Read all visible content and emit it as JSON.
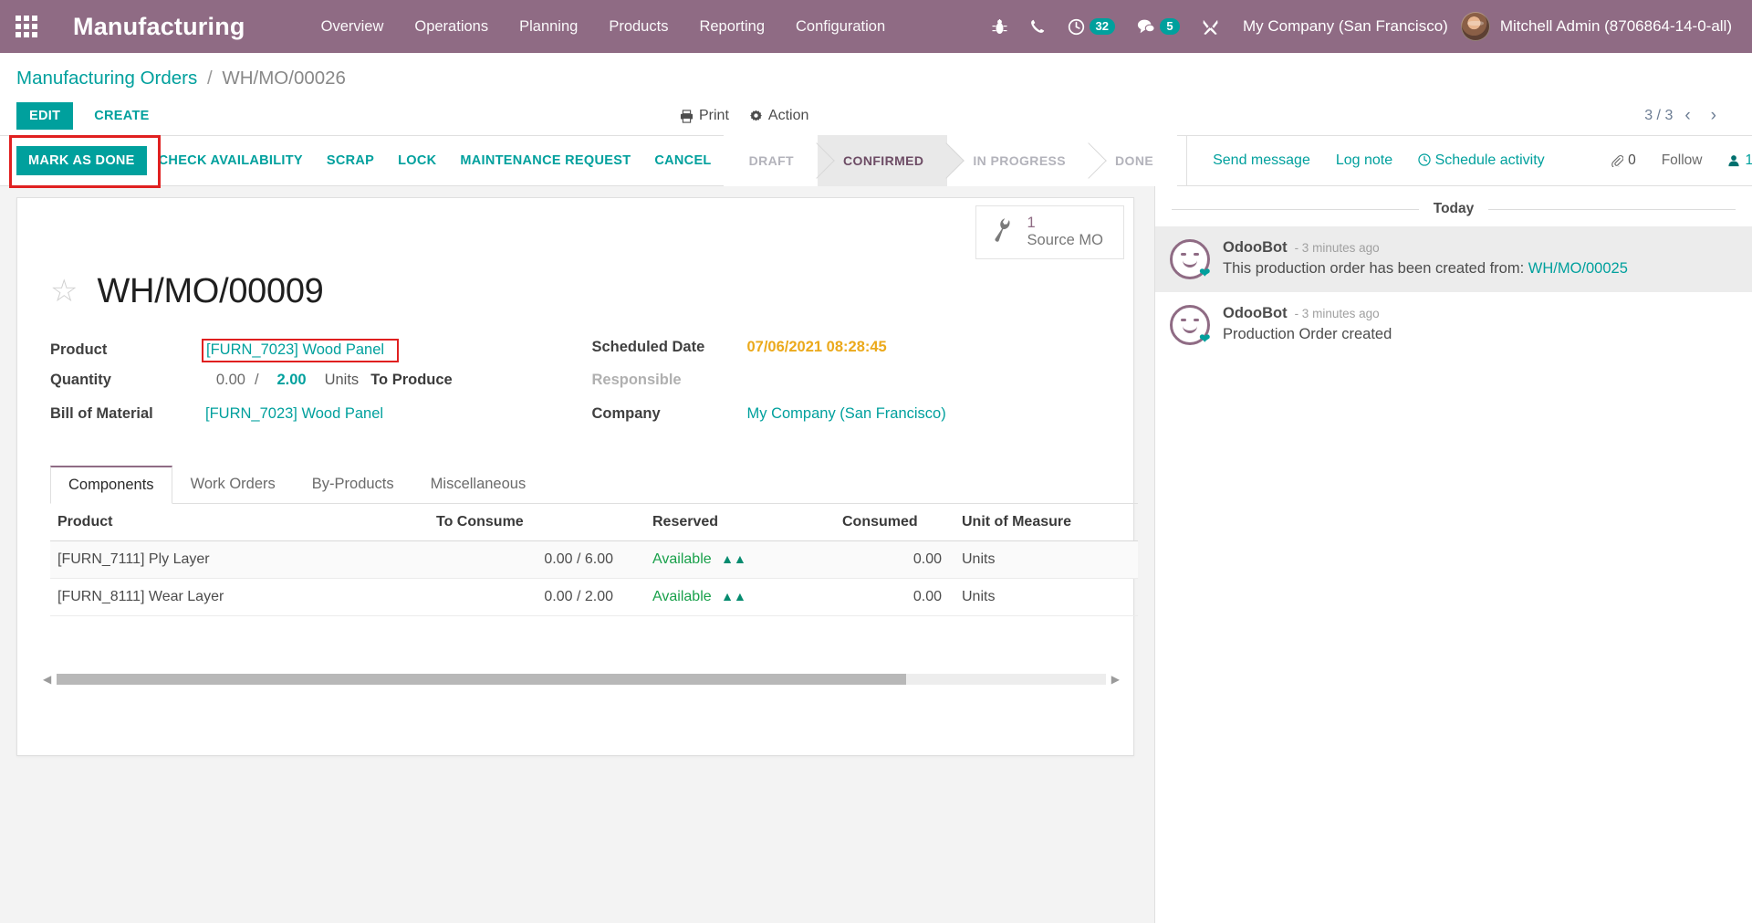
{
  "navbar": {
    "apps_icon": "apps-grid-icon",
    "brand": "Manufacturing",
    "menu": [
      "Overview",
      "Operations",
      "Planning",
      "Products",
      "Reporting",
      "Configuration"
    ],
    "sys_icons": [
      {
        "name": "bug-icon",
        "glyph": "☣"
      },
      {
        "name": "phone-icon",
        "glyph": "✆"
      }
    ],
    "activity_count": "32",
    "message_count": "5",
    "tools_icon": "tools-icon",
    "company": "My Company (San Francisco)",
    "user": "Mitchell Admin (8706864-14-0-all)"
  },
  "breadcrumb": {
    "root": "Manufacturing Orders",
    "separator": "/",
    "current": "WH/MO/00026"
  },
  "control": {
    "edit": "EDIT",
    "create": "CREATE",
    "print": "Print",
    "action": "Action",
    "pager": "3 / 3",
    "prev": "‹",
    "next": "›"
  },
  "statusbar": {
    "buttons": [
      {
        "label": "MARK AS DONE",
        "primary": true,
        "highlighted": true
      },
      {
        "label": "CHECK AVAILABILITY",
        "primary": false
      },
      {
        "label": "SCRAP",
        "primary": false
      },
      {
        "label": "LOCK",
        "primary": false
      },
      {
        "label": "MAINTENANCE REQUEST",
        "primary": false
      },
      {
        "label": "CANCEL",
        "primary": false
      }
    ],
    "stages": [
      "DRAFT",
      "CONFIRMED",
      "IN PROGRESS",
      "DONE"
    ],
    "active_stage": "CONFIRMED"
  },
  "chatter": {
    "send_message": "Send message",
    "log_note": "Log note",
    "schedule_activity": "Schedule activity",
    "attachment_count": "0",
    "follow": "Follow",
    "follower_count": "1",
    "day_separator": "Today",
    "messages": [
      {
        "author": "OdooBot",
        "time": "- 3 minutes ago",
        "text": "This production order has been created from: ",
        "link": "WH/MO/00025"
      },
      {
        "author": "OdooBot",
        "time": "- 3 minutes ago",
        "text": "Production Order created",
        "link": ""
      }
    ]
  },
  "form": {
    "stat_button": {
      "value": "1",
      "label": "Source MO",
      "icon": "wrench-icon"
    },
    "star_icon": "star-outline-icon",
    "title": "WH/MO/00009",
    "left_fields": [
      {
        "label": "Product",
        "value": "[FURN_7023] Wood Panel",
        "type": "link",
        "highlighted": true
      },
      {
        "label": "Quantity",
        "type": "quantity"
      },
      {
        "label": "Bill of Material",
        "value": "[FURN_7023] Wood Panel",
        "type": "link",
        "highlighted": false
      }
    ],
    "quantity": {
      "done": "0.00",
      "separator": "/",
      "todo": "2.00",
      "uom": "Units",
      "suffix": "To Produce"
    },
    "right_fields": [
      {
        "label": "Scheduled Date",
        "value": "07/06/2021 08:28:45",
        "type": "orange"
      },
      {
        "label": "Responsible",
        "value": "",
        "type": "muted"
      },
      {
        "label": "Company",
        "value": "My Company (San Francisco)",
        "type": "link"
      }
    ],
    "tabs": [
      {
        "label": "Components",
        "active": true
      },
      {
        "label": "Work Orders",
        "active": false
      },
      {
        "label": "By-Products",
        "active": false
      },
      {
        "label": "Miscellaneous",
        "active": false
      }
    ],
    "table": {
      "columns": [
        "Product",
        "To Consume",
        "Reserved",
        "Consumed",
        "Unit of Measure"
      ],
      "rows": [
        {
          "product": "[FURN_7111] Ply Layer",
          "to_consume": "0.00 / 6.00",
          "reserved": "Available",
          "consumed": "0.00",
          "uom": "Units"
        },
        {
          "product": "[FURN_8111] Wear Layer",
          "to_consume": "0.00 / 2.00",
          "reserved": "Available",
          "consumed": "0.00",
          "uom": "Units"
        }
      ]
    }
  },
  "colors": {
    "brand_purple": "#8f6b84",
    "accent_teal": "#00A09D",
    "warning_orange": "#eba91b",
    "highlight_red": "#e02020",
    "available_green": "#18a04a"
  }
}
